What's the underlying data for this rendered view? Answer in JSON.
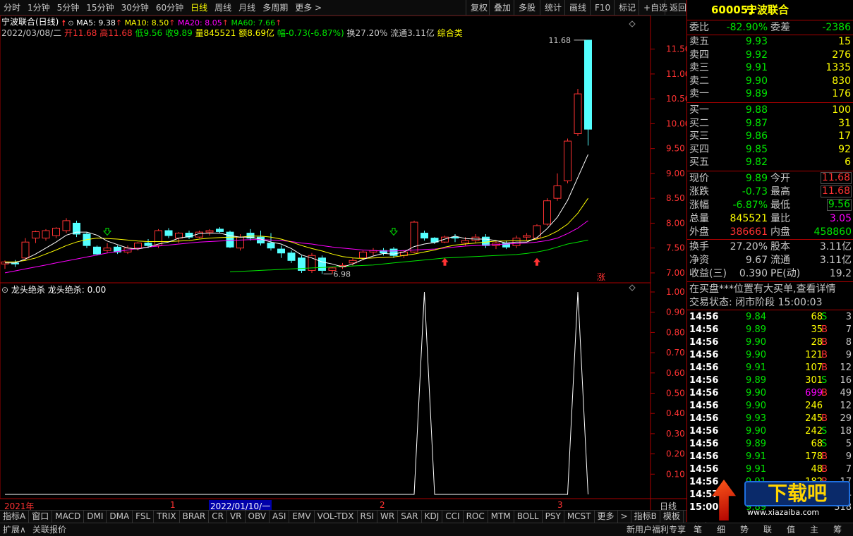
{
  "topbar": {
    "periods": [
      "分时",
      "1分钟",
      "5分钟",
      "15分钟",
      "30分钟",
      "60分钟",
      "日线",
      "周线",
      "月线",
      "多周期",
      "更多 >"
    ],
    "active_period": "日线",
    "tools": [
      "复权",
      "叠加",
      "多股",
      "统计",
      "画线",
      "F10",
      "标记",
      "+自选",
      "返回"
    ]
  },
  "info_line": {
    "stock_title": "宁波联合(日线)",
    "date": "2022/03/08/二",
    "open_label": "开",
    "open": "11.68",
    "high_label": "高",
    "high": "11.68",
    "low_label": "低",
    "low": "9.56",
    "close_label": "收",
    "close": "9.89",
    "volume_label": "量",
    "volume": "845521",
    "amount_label": "额",
    "amount": "8.69亿",
    "change_label": "幅",
    "change": "-0.73(-6.87%)",
    "turnover_label": "换",
    "turnover": "27.20%",
    "float_label": "流通",
    "float": "3.11亿",
    "category": "综合类"
  },
  "ma": {
    "ma5": "MA5: 9.38",
    "ma10": "MA10: 8.50",
    "ma20": "MA20: 8.05",
    "ma60": "MA60: 7.66",
    "arrow": "↑"
  },
  "colors": {
    "up": "#ff3232",
    "down": "#54ffff",
    "ma5": "#ffffff",
    "ma10": "#ffff00",
    "ma20": "#ff00ff",
    "ma60": "#00e600",
    "frame": "#aa0000"
  },
  "price_axis": [
    "11.50",
    "11.00",
    "10.50",
    "10.00",
    "9.50",
    "9.00",
    "8.50",
    "8.00",
    "7.50",
    "7.00"
  ],
  "indicator_axis": [
    "1.00",
    "0.90",
    "0.80",
    "0.70",
    "0.60",
    "0.50",
    "0.40",
    "0.30",
    "0.20",
    "0.10"
  ],
  "annotations": {
    "high_label": "11.68",
    "low_label": "6.98",
    "zhang_badge": "涨"
  },
  "indicator": {
    "title": "龙头绝杀",
    "value_text": "龙头绝杀: 0.00"
  },
  "time_axis": {
    "year": "2021年",
    "m1": "1",
    "cursor_date": "2022/01/10/一",
    "m2": "2",
    "m3": "3",
    "period_label": "日线"
  },
  "indicators_bar": [
    "指标A",
    "窗口",
    "MACD",
    "DMI",
    "DMA",
    "FSL",
    "TRIX",
    "BRAR",
    "CR",
    "VR",
    "OBV",
    "ASI",
    "EMV",
    "VOL-TDX",
    "RSI",
    "WR",
    "SAR",
    "KDJ",
    "CCI",
    "ROC",
    "MTM",
    "BOLL",
    "PSY",
    "MCST",
    "更多",
    ">",
    "指标B",
    "模板",
    "+",
    "-"
  ],
  "statusbar": {
    "expand": "扩展∧",
    "related": "关联报价",
    "promo": "新用户福利专享",
    "tabs": [
      "笔",
      "细",
      "势",
      "联",
      "值",
      "主",
      "筹"
    ],
    "watermark": "下载吧",
    "watermark_url": "www.xiazaiba.com"
  },
  "right": {
    "code": "600051",
    "name": "宁波联合",
    "weibi_label": "委比",
    "weibi": "-82.90%",
    "weicha_label": "委差",
    "weicha": "-2386",
    "asks": [
      {
        "label": "卖五",
        "price": "9.93",
        "vol": "15"
      },
      {
        "label": "卖四",
        "price": "9.92",
        "vol": "276"
      },
      {
        "label": "卖三",
        "price": "9.91",
        "vol": "1335"
      },
      {
        "label": "卖二",
        "price": "9.90",
        "vol": "830"
      },
      {
        "label": "卖一",
        "price": "9.89",
        "vol": "176"
      }
    ],
    "bids": [
      {
        "label": "买一",
        "price": "9.88",
        "vol": "100"
      },
      {
        "label": "买二",
        "price": "9.87",
        "vol": "31"
      },
      {
        "label": "买三",
        "price": "9.86",
        "vol": "17"
      },
      {
        "label": "买四",
        "price": "9.85",
        "vol": "92"
      },
      {
        "label": "买五",
        "price": "9.82",
        "vol": "6"
      }
    ],
    "stats": [
      {
        "l1": "现价",
        "v1": "9.89",
        "c1": "green",
        "l2": "今开",
        "v2": "11.68",
        "c2": "red",
        "box": true
      },
      {
        "l1": "涨跌",
        "v1": "-0.73",
        "c1": "green",
        "l2": "最高",
        "v2": "11.68",
        "c2": "red",
        "box": true
      },
      {
        "l1": "涨幅",
        "v1": "-6.87%",
        "c1": "green",
        "l2": "最低",
        "v2": "9.56",
        "c2": "green",
        "box": true
      },
      {
        "l1": "总量",
        "v1": "845521",
        "c1": "yellow",
        "l2": "量比",
        "v2": "3.05",
        "c2": "mag",
        "box": false
      },
      {
        "l1": "外盘",
        "v1": "386661",
        "c1": "red",
        "l2": "内盘",
        "v2": "458860",
        "c2": "green",
        "box": false
      }
    ],
    "stats2": [
      {
        "l1": "换手",
        "v1": "27.20%",
        "l2": "股本",
        "v2": "3.11亿"
      },
      {
        "l1": "净资",
        "v1": "9.67",
        "l2": "流通",
        "v2": "3.11亿"
      },
      {
        "l1": "收益(三)",
        "v1": "0.390",
        "l2": "PE(动)",
        "v2": "19.2"
      }
    ],
    "notice": "在买盘***位置有大买单,查看详情",
    "trade_status": "交易状态: 闭市阶段 15:00:03",
    "ticks": [
      {
        "t": "14:56",
        "p": "9.84",
        "v": "68",
        "s": "S",
        "n": "3"
      },
      {
        "t": "14:56",
        "p": "9.89",
        "v": "35",
        "s": "B",
        "n": "7"
      },
      {
        "t": "14:56",
        "p": "9.90",
        "v": "28",
        "s": "B",
        "n": "8"
      },
      {
        "t": "14:56",
        "p": "9.90",
        "v": "121",
        "s": "B",
        "n": "9"
      },
      {
        "t": "14:56",
        "p": "9.91",
        "v": "107",
        "s": "B",
        "n": "12"
      },
      {
        "t": "14:56",
        "p": "9.89",
        "v": "301",
        "s": "S",
        "n": "16"
      },
      {
        "t": "14:56",
        "p": "9.90",
        "v": "699",
        "s": "B",
        "n": "49"
      },
      {
        "t": "14:56",
        "p": "9.90",
        "v": "246",
        "s": "",
        "n": "12"
      },
      {
        "t": "14:56",
        "p": "9.93",
        "v": "245",
        "s": "B",
        "n": "29"
      },
      {
        "t": "14:56",
        "p": "9.90",
        "v": "242",
        "s": "S",
        "n": "18"
      },
      {
        "t": "14:56",
        "p": "9.89",
        "v": "68",
        "s": "S",
        "n": "5"
      },
      {
        "t": "14:56",
        "p": "9.91",
        "v": "178",
        "s": "B",
        "n": "9"
      },
      {
        "t": "14:56",
        "p": "9.91",
        "v": "48",
        "s": "B",
        "n": "7"
      },
      {
        "t": "14:56",
        "p": "9.91",
        "v": "182",
        "s": "B",
        "n": "17"
      },
      {
        "t": "14:57",
        "p": "9.91",
        "v": "23",
        "s": "S",
        "n": "4"
      },
      {
        "t": "15:00",
        "p": "9.89",
        "v": "",
        "s": "",
        "n": "318"
      }
    ]
  },
  "chart_data": {
    "type": "candlestick",
    "candles": [
      {
        "o": 7.18,
        "h": 7.25,
        "l": 7.08,
        "c": 7.22
      },
      {
        "o": 7.2,
        "h": 7.26,
        "l": 7.12,
        "c": 7.18
      },
      {
        "o": 7.3,
        "h": 7.7,
        "l": 7.25,
        "c": 7.62
      },
      {
        "o": 7.7,
        "h": 7.85,
        "l": 7.6,
        "c": 7.83
      },
      {
        "o": 7.7,
        "h": 7.88,
        "l": 7.65,
        "c": 7.85
      },
      {
        "o": 7.75,
        "h": 7.92,
        "l": 7.7,
        "c": 7.9
      },
      {
        "o": 7.85,
        "h": 8.1,
        "l": 7.8,
        "c": 8.05
      },
      {
        "o": 8.0,
        "h": 8.05,
        "l": 7.72,
        "c": 7.78
      },
      {
        "o": 7.78,
        "h": 7.82,
        "l": 7.5,
        "c": 7.55
      },
      {
        "o": 7.52,
        "h": 7.55,
        "l": 7.35,
        "c": 7.38
      },
      {
        "o": 7.45,
        "h": 7.6,
        "l": 7.4,
        "c": 7.5
      },
      {
        "o": 7.52,
        "h": 7.55,
        "l": 7.38,
        "c": 7.42
      },
      {
        "o": 7.42,
        "h": 7.55,
        "l": 7.38,
        "c": 7.5
      },
      {
        "o": 7.5,
        "h": 7.62,
        "l": 7.45,
        "c": 7.6
      },
      {
        "o": 7.6,
        "h": 7.68,
        "l": 7.5,
        "c": 7.55
      },
      {
        "o": 7.55,
        "h": 7.88,
        "l": 7.5,
        "c": 7.85
      },
      {
        "o": 7.85,
        "h": 7.9,
        "l": 7.7,
        "c": 7.75
      },
      {
        "o": 7.7,
        "h": 7.82,
        "l": 7.6,
        "c": 7.8
      },
      {
        "o": 7.8,
        "h": 7.85,
        "l": 7.68,
        "c": 7.72
      },
      {
        "o": 7.72,
        "h": 7.85,
        "l": 7.7,
        "c": 7.82
      },
      {
        "o": 7.82,
        "h": 7.88,
        "l": 7.75,
        "c": 7.85
      },
      {
        "o": 7.88,
        "h": 7.92,
        "l": 7.8,
        "c": 7.83
      },
      {
        "o": 7.82,
        "h": 7.85,
        "l": 7.5,
        "c": 7.52
      },
      {
        "o": 7.5,
        "h": 7.78,
        "l": 7.45,
        "c": 7.72
      },
      {
        "o": 7.8,
        "h": 7.88,
        "l": 7.65,
        "c": 7.7
      },
      {
        "o": 7.72,
        "h": 7.85,
        "l": 7.55,
        "c": 7.6
      },
      {
        "o": 7.6,
        "h": 7.8,
        "l": 7.45,
        "c": 7.5
      },
      {
        "o": 7.48,
        "h": 7.55,
        "l": 7.3,
        "c": 7.4
      },
      {
        "o": 7.4,
        "h": 7.45,
        "l": 7.2,
        "c": 7.25
      },
      {
        "o": 7.3,
        "h": 7.35,
        "l": 7.0,
        "c": 7.05
      },
      {
        "o": 7.05,
        "h": 7.4,
        "l": 7.0,
        "c": 7.35
      },
      {
        "o": 7.3,
        "h": 7.35,
        "l": 6.98,
        "c": 7.05
      },
      {
        "o": 7.05,
        "h": 7.12,
        "l": 6.98,
        "c": 7.1
      },
      {
        "o": 7.12,
        "h": 7.2,
        "l": 7.08,
        "c": 7.15
      },
      {
        "o": 7.2,
        "h": 7.3,
        "l": 7.15,
        "c": 7.25
      },
      {
        "o": 7.3,
        "h": 7.45,
        "l": 7.25,
        "c": 7.42
      },
      {
        "o": 7.42,
        "h": 7.5,
        "l": 7.35,
        "c": 7.45
      },
      {
        "o": 7.45,
        "h": 7.5,
        "l": 7.35,
        "c": 7.4
      },
      {
        "o": 7.48,
        "h": 7.52,
        "l": 7.3,
        "c": 7.35
      },
      {
        "o": 7.35,
        "h": 7.45,
        "l": 7.3,
        "c": 7.42
      },
      {
        "o": 7.42,
        "h": 8.05,
        "l": 7.4,
        "c": 8.02
      },
      {
        "o": 7.8,
        "h": 7.85,
        "l": 7.65,
        "c": 7.7
      },
      {
        "o": 7.7,
        "h": 7.72,
        "l": 7.58,
        "c": 7.62
      },
      {
        "o": 7.62,
        "h": 7.75,
        "l": 7.6,
        "c": 7.72
      },
      {
        "o": 7.72,
        "h": 7.78,
        "l": 7.62,
        "c": 7.7
      },
      {
        "o": 7.6,
        "h": 7.72,
        "l": 7.55,
        "c": 7.65
      },
      {
        "o": 7.65,
        "h": 7.78,
        "l": 7.6,
        "c": 7.72
      },
      {
        "o": 7.72,
        "h": 7.78,
        "l": 7.5,
        "c": 7.55
      },
      {
        "o": 7.55,
        "h": 7.65,
        "l": 7.48,
        "c": 7.6
      },
      {
        "o": 7.6,
        "h": 7.65,
        "l": 7.48,
        "c": 7.52
      },
      {
        "o": 7.55,
        "h": 7.75,
        "l": 7.5,
        "c": 7.7
      },
      {
        "o": 7.72,
        "h": 7.8,
        "l": 7.65,
        "c": 7.75
      },
      {
        "o": 7.7,
        "h": 7.98,
        "l": 7.68,
        "c": 7.95
      },
      {
        "o": 7.98,
        "h": 8.5,
        "l": 7.95,
        "c": 8.45
      },
      {
        "o": 8.5,
        "h": 9.0,
        "l": 8.45,
        "c": 8.75
      },
      {
        "o": 8.85,
        "h": 9.7,
        "l": 8.8,
        "c": 9.65
      },
      {
        "o": 9.8,
        "h": 10.7,
        "l": 9.75,
        "c": 10.6
      },
      {
        "o": 11.68,
        "h": 11.68,
        "l": 9.56,
        "c": 9.89
      }
    ],
    "ma5": [
      7.2,
      7.2,
      7.28,
      7.38,
      7.5,
      7.62,
      7.76,
      7.82,
      7.82,
      7.76,
      7.64,
      7.57,
      7.5,
      7.48,
      7.52,
      7.58,
      7.62,
      7.7,
      7.73,
      7.79,
      7.8,
      7.8,
      7.75,
      7.72,
      7.72,
      7.68,
      7.62,
      7.58,
      7.49,
      7.36,
      7.3,
      7.22,
      7.18,
      7.12,
      7.18,
      7.27,
      7.34,
      7.39,
      7.38,
      7.42,
      7.53,
      7.58,
      7.61,
      7.68,
      7.74,
      7.69,
      7.68,
      7.68,
      7.65,
      7.6,
      7.62,
      7.62,
      7.71,
      7.89,
      8.12,
      8.46,
      8.92,
      9.38
    ],
    "ma10": [
      7.22,
      7.22,
      7.25,
      7.3,
      7.38,
      7.46,
      7.55,
      7.62,
      7.67,
      7.7,
      7.69,
      7.68,
      7.66,
      7.64,
      7.63,
      7.63,
      7.63,
      7.64,
      7.65,
      7.68,
      7.7,
      7.71,
      7.72,
      7.72,
      7.74,
      7.74,
      7.72,
      7.68,
      7.62,
      7.55,
      7.49,
      7.44,
      7.38,
      7.33,
      7.3,
      7.29,
      7.3,
      7.31,
      7.32,
      7.35,
      7.38,
      7.42,
      7.46,
      7.52,
      7.56,
      7.58,
      7.6,
      7.62,
      7.64,
      7.64,
      7.65,
      7.65,
      7.68,
      7.74,
      7.84,
      7.98,
      8.2,
      8.5
    ],
    "ma20": [
      7.0,
      7.04,
      7.08,
      7.12,
      7.16,
      7.2,
      7.24,
      7.28,
      7.32,
      7.36,
      7.4,
      7.43,
      7.46,
      7.49,
      7.52,
      7.54,
      7.56,
      7.58,
      7.6,
      7.62,
      7.63,
      7.64,
      7.65,
      7.66,
      7.67,
      7.67,
      7.66,
      7.65,
      7.63,
      7.6,
      7.58,
      7.55,
      7.52,
      7.5,
      7.48,
      7.46,
      7.45,
      7.44,
      7.44,
      7.45,
      7.46,
      7.47,
      7.48,
      7.5,
      7.52,
      7.54,
      7.55,
      7.56,
      7.57,
      7.58,
      7.59,
      7.6,
      7.62,
      7.65,
      7.7,
      7.79,
      7.9,
      8.05
    ],
    "ma60_start": 22,
    "ma60": [
      7.02,
      7.03,
      7.04,
      7.05,
      7.06,
      7.07,
      7.08,
      7.09,
      7.1,
      7.11,
      7.12,
      7.13,
      7.14,
      7.15,
      7.16,
      7.18,
      7.2,
      7.22,
      7.24,
      7.26,
      7.28,
      7.3,
      7.31,
      7.32,
      7.33,
      7.34,
      7.35,
      7.36,
      7.37,
      7.39,
      7.42,
      7.46,
      7.52,
      7.58,
      7.62,
      7.66
    ],
    "signal": {
      "peaks": [
        41,
        56
      ],
      "value": 1.0
    },
    "ylim": [
      6.9,
      11.75
    ]
  }
}
